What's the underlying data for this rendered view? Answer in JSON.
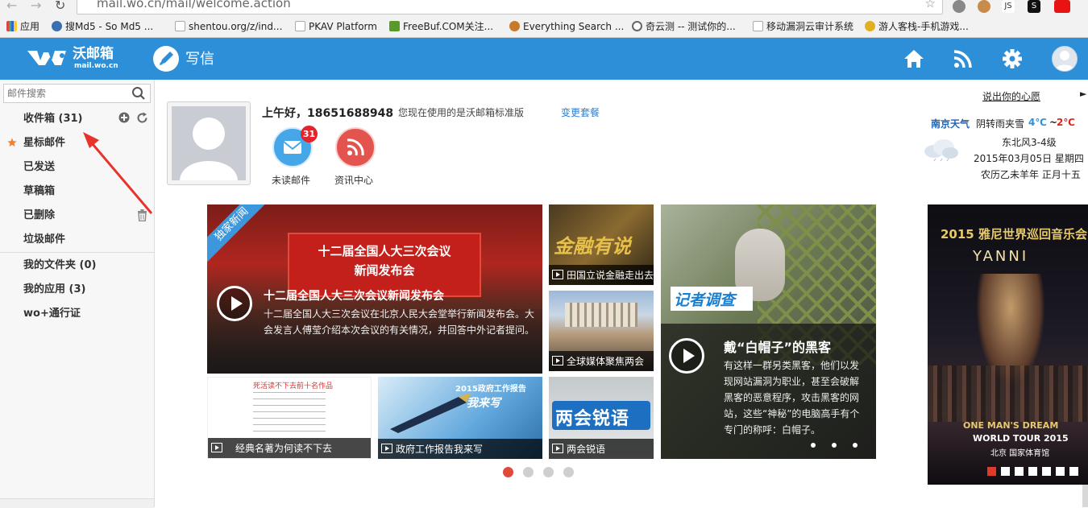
{
  "browser": {
    "url": "mail.wo.cn/mail/welcome.action",
    "bookmarks": [
      {
        "label": "应用",
        "color": "#d44"
      },
      {
        "label": "搜Md5 - So Md5 ...",
        "color": "#3a6fb0"
      },
      {
        "label": "shentou.org/z/ind...",
        "color": "#aaa"
      },
      {
        "label": "PKAV Platform",
        "color": "#aaa"
      },
      {
        "label": "FreeBuf.COM关注...",
        "color": "#5a9a2a"
      },
      {
        "label": "Everything Search ...",
        "color": "#c77b2a"
      },
      {
        "label": "奇云测 -- 测试你的...",
        "color": "#777"
      },
      {
        "label": "移动漏洞云审计系统",
        "color": "#aaa"
      },
      {
        "label": "游人客栈-手机游戏...",
        "color": "#e0b020"
      }
    ],
    "extensions": [
      "JS",
      "S"
    ]
  },
  "header": {
    "logo_title": "沃邮箱",
    "logo_sub": "mail.wo.cn",
    "compose_label": "写信",
    "icons": [
      "home-icon",
      "rss-icon",
      "gear-icon",
      "user-avatar-icon"
    ],
    "bg_color": "#2d8fd8"
  },
  "sidebar": {
    "search_placeholder": "邮件搜索",
    "folders": [
      {
        "label": "收件箱 (31)"
      },
      {
        "label": "星标邮件"
      },
      {
        "label": "已发送"
      },
      {
        "label": "草稿箱"
      },
      {
        "label": "已删除"
      },
      {
        "label": "垃圾邮件"
      },
      {
        "label": "我的文件夹 (0)"
      },
      {
        "label": "我的应用 (3)"
      },
      {
        "label": "wo+通行证"
      }
    ]
  },
  "welcome": {
    "greeting": "上午好，18651688948",
    "version_text": "您现在使用的是沃邮箱标准版",
    "change_plan": "变更套餐",
    "unread_count": "31",
    "unread_label": "未读邮件",
    "news_center_label": "资讯中心"
  },
  "weather": {
    "feedback": "说出你的心愿",
    "city": "南京天气",
    "desc": "阴转雨夹雪",
    "low": "4℃",
    "sep": "~",
    "high": "2℃",
    "wind": "东北风3-4级",
    "date": "2015年03月05日 星期四",
    "lunar": "农历乙未羊年 正月十五"
  },
  "news": {
    "main_badge": "独家新闻",
    "main_banner_line1": "十二届全国人大三次会议",
    "main_banner_line2": "新闻发布会",
    "main_title": "十二届全国人大三次会议新闻发布会",
    "main_desc": "十二届全国人大三次会议在北京人民大会堂举行新闻发布会。大会发言人傅莹介绍本次会议的有关情况，并回答中外记者提问。",
    "side_tiles": [
      {
        "caption": "田国立说金融走出去",
        "art": "金融有说"
      },
      {
        "caption": "全球媒体聚焦两会"
      },
      {
        "caption": "两会锐语",
        "art": "两会锐语"
      }
    ],
    "bottom_tiles": [
      {
        "caption": "经典名著为何读不下去",
        "art": "死活读不下去前十名作品"
      },
      {
        "caption": "政府工作报告我来写",
        "art": "2015政府工作报告",
        "art2": "我来写"
      }
    ],
    "feature": {
      "badge": "记者调查",
      "title": "戴“白帽子”的黑客",
      "desc": "有这样一群另类黑客，他们以发现网站漏洞为职业，甚至会破解黑客的恶意程序，攻击黑客的网站，这些“神秘”的电脑高手有个专门的称呼：白帽子。"
    },
    "slides_total": 4,
    "slide_active": 1
  },
  "ad": {
    "title": "2015 雅尼世界巡回音乐会",
    "artist": "YANNI",
    "tagline": "ONE MAN'S DREAM",
    "tour": "WORLD TOUR 2015",
    "venue": "北京 国家体育馆",
    "slides_total": 7,
    "slide_active": 1
  }
}
